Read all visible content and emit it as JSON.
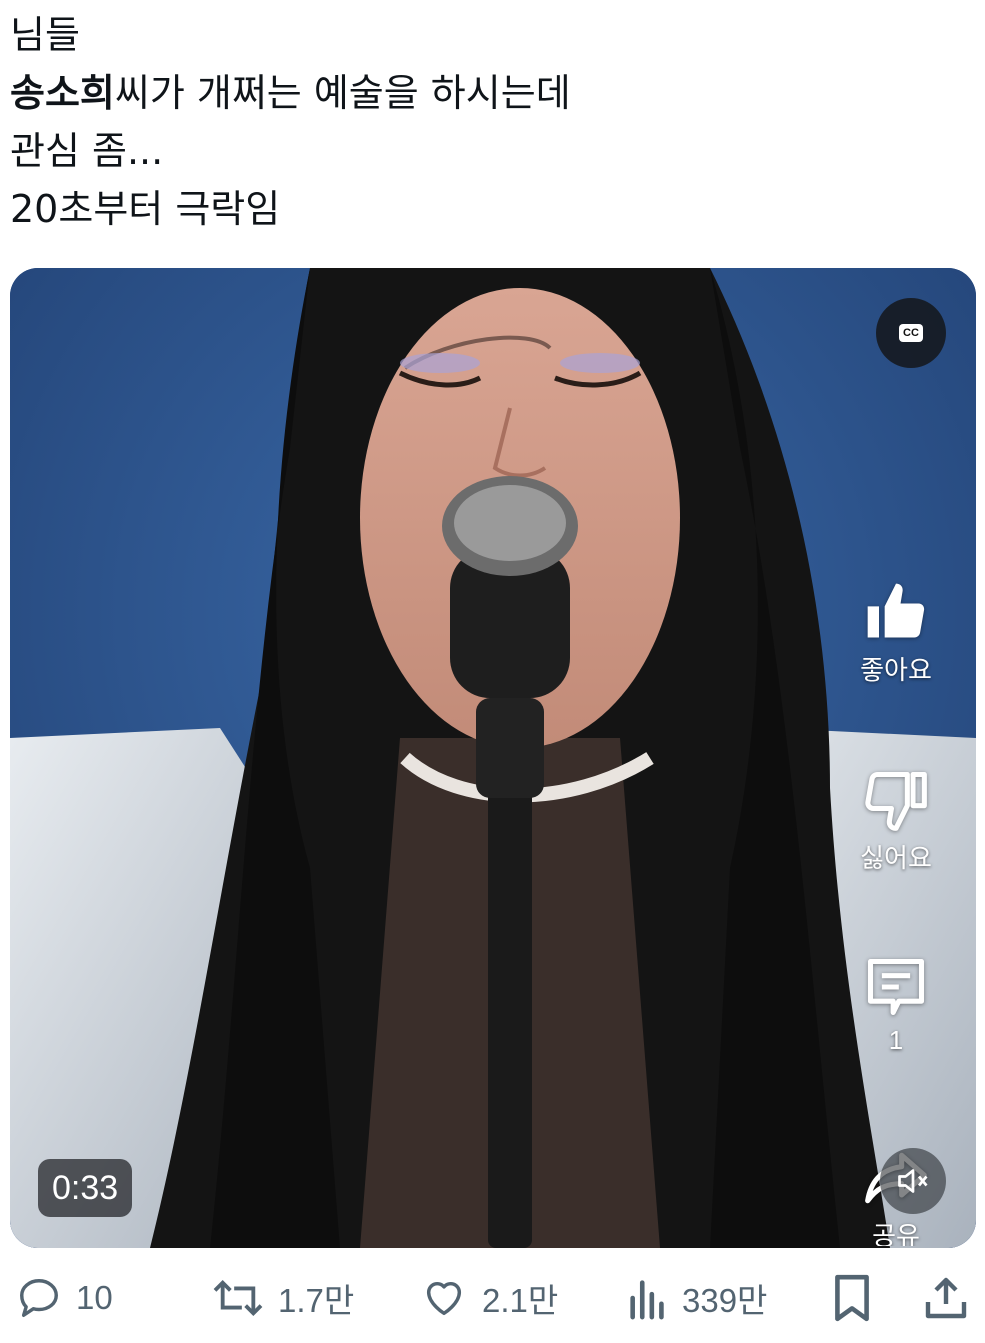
{
  "post": {
    "line1": "님들",
    "line2_bold": "송소희",
    "line2_rest": "씨가 개쩌는 예술을 하시는데",
    "line3": "관심 좀...",
    "line4": "20초부터 극락임"
  },
  "video": {
    "cc_label": "CC",
    "timestamp": "0:33",
    "like_label": "좋아요",
    "dislike_label": "싫어요",
    "comment_count": "1",
    "share_label": "공유"
  },
  "actions": {
    "replies": "10",
    "reposts": "1.7만",
    "likes": "2.1만",
    "views": "339만"
  },
  "colors": {
    "action_gray": "#536471",
    "backdrop_blue": "#2a4f86"
  }
}
